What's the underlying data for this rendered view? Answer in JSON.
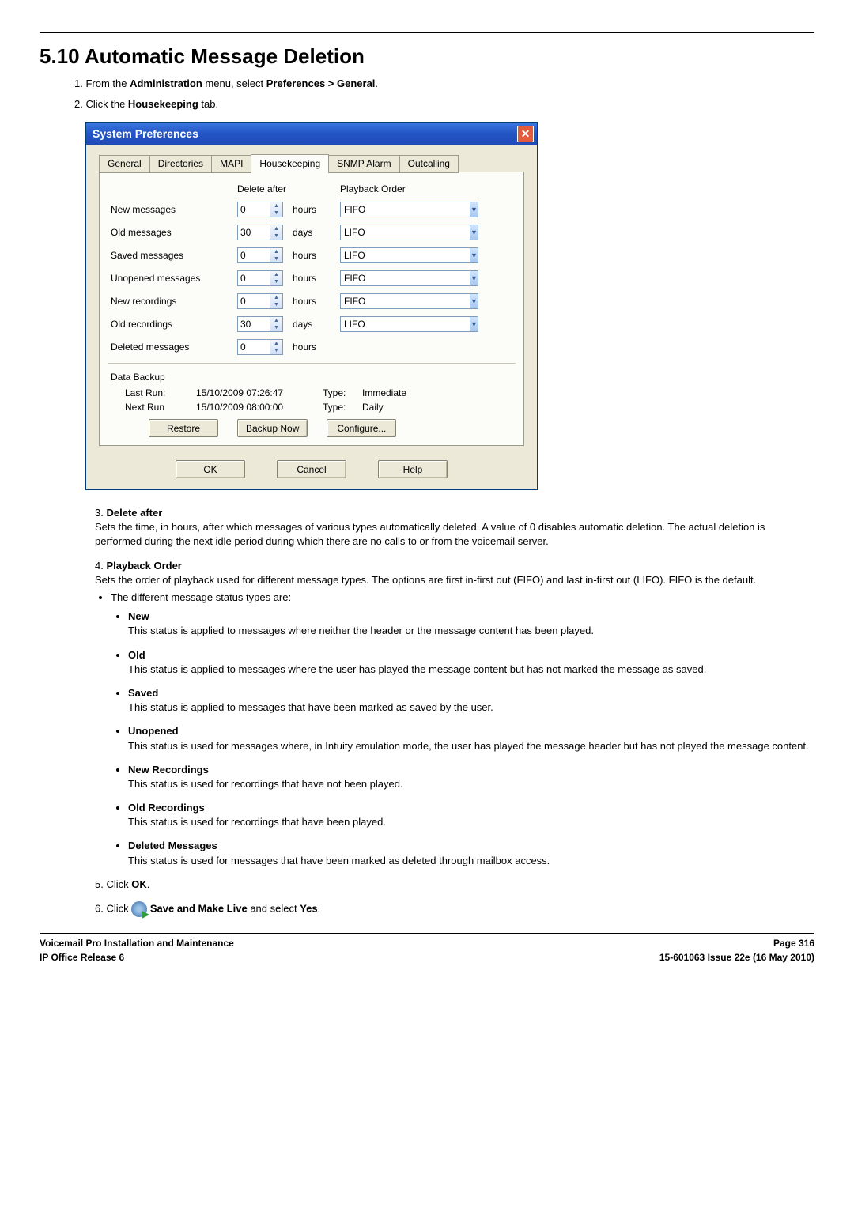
{
  "heading": "5.10 Automatic Message Deletion",
  "step1": {
    "prefix": "1. From the ",
    "bold1": "Administration",
    "mid": " menu, select ",
    "bold2": "Preferences > General",
    "end": "."
  },
  "step2": {
    "prefix": "2. Click the ",
    "bold": "Housekeeping",
    "end": " tab."
  },
  "dialog": {
    "title": "System Preferences",
    "closeGlyph": "✕",
    "tabs": {
      "general": "General",
      "directories": "Directories",
      "mapi": "MAPI",
      "housekeeping": "Housekeeping",
      "snmp": "SNMP Alarm",
      "outcalling": "Outcalling"
    },
    "col_delete_after": "Delete after",
    "col_playback_order": "Playback Order",
    "rows": {
      "new_messages": {
        "label": "New messages",
        "value": "0",
        "unit": "hours",
        "order": "FIFO"
      },
      "old_messages": {
        "label": "Old messages",
        "value": "30",
        "unit": "days",
        "order": "LIFO"
      },
      "saved_messages": {
        "label": "Saved messages",
        "value": "0",
        "unit": "hours",
        "order": "LIFO"
      },
      "unopened": {
        "label": "Unopened messages",
        "value": "0",
        "unit": "hours",
        "order": "FIFO"
      },
      "new_rec": {
        "label": "New recordings",
        "value": "0",
        "unit": "hours",
        "order": "FIFO"
      },
      "old_rec": {
        "label": "Old recordings",
        "value": "30",
        "unit": "days",
        "order": "LIFO"
      },
      "deleted": {
        "label": "Deleted messages",
        "value": "0",
        "unit": "hours"
      }
    },
    "backup": {
      "heading": "Data Backup",
      "last_run_label": "Last Run:",
      "last_run_value": "15/10/2009 07:26:47",
      "last_type_label": "Type:",
      "last_type_value": "Immediate",
      "next_run_label": "Next Run",
      "next_run_value": "15/10/2009 08:00:00",
      "next_type_label": "Type:",
      "next_type_value": "Daily",
      "restore": "Restore",
      "backup_now": "Backup Now",
      "configure": "Configure..."
    },
    "ok": "OK",
    "cancel": "Cancel",
    "help": "Help"
  },
  "item3": {
    "num": "3.",
    "title": "Delete after",
    "body": "Sets the time, in hours, after which messages of various types automatically deleted. A value of 0 disables automatic deletion. The actual deletion is performed during the next idle period during which there are no calls to or from the voicemail server."
  },
  "item4": {
    "num": "4.",
    "title": "Playback Order",
    "body": "Sets the order of playback used for different message types. The options are first in-first out (FIFO) and last in-first out (LIFO). FIFO is the default.",
    "bullet_intro": "The different message status types are:",
    "types": {
      "new": {
        "title": "New",
        "body": "This status is applied to messages where neither the header or the message content has been played."
      },
      "old": {
        "title": "Old",
        "body": "This status is applied to messages where the user has played the message content but has not marked the message as saved."
      },
      "saved": {
        "title": "Saved",
        "body": "This status is applied to messages that have been marked as saved by the user."
      },
      "unopened": {
        "title": "Unopened",
        "body": "This status is used for messages where, in Intuity emulation mode, the user has played the message header but has not played the message content."
      },
      "new_rec": {
        "title": "New Recordings",
        "body": "This status is used for recordings that have not been played."
      },
      "old_rec": {
        "title": "Old Recordings",
        "body": "This status is used for recordings that have been played."
      },
      "del_msg": {
        "title": "Deleted Messages",
        "body": "This status is used for messages that have been marked as deleted through mailbox access."
      }
    }
  },
  "step5": {
    "prefix": "5. Click ",
    "bold": "OK",
    "end": "."
  },
  "step6": {
    "prefix": "6. Click ",
    "bold1": "Save and Make Live",
    "mid": " and select ",
    "bold2": "Yes",
    "end": "."
  },
  "footer": {
    "left1": "Voicemail Pro Installation and Maintenance",
    "right1": "Page 316",
    "left2": "IP Office Release 6",
    "right2": "15-601063 Issue 22e (16 May 2010)"
  }
}
